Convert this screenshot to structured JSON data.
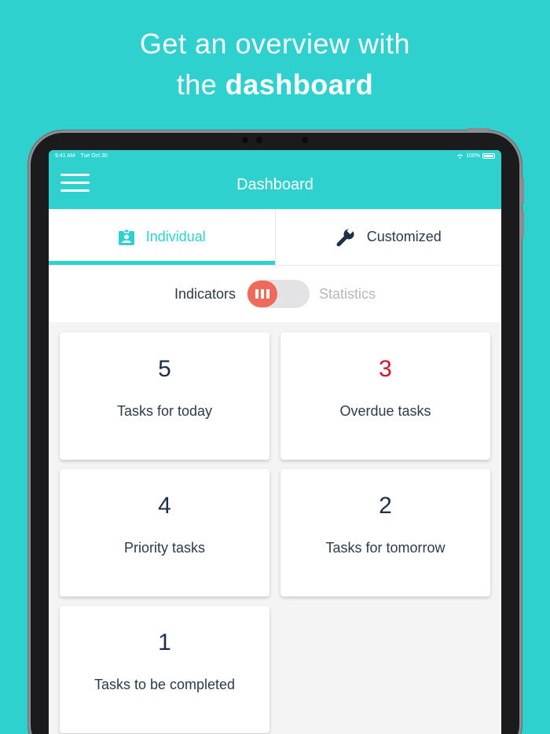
{
  "headline": {
    "line1": "Get an overview with",
    "line2_prefix": "the",
    "line2_bold": "dashboard"
  },
  "status_bar": {
    "time": "9:41 AM",
    "date": "Tue Oct 30",
    "battery": "100%"
  },
  "app_bar": {
    "title": "Dashboard",
    "menu_icon": "hamburger-menu-icon"
  },
  "tabs": [
    {
      "label": "Individual",
      "icon": "id-badge-icon",
      "active": true
    },
    {
      "label": "Customized",
      "icon": "wrench-icon",
      "active": false
    }
  ],
  "view_toggle": {
    "left_label": "Indicators",
    "right_label": "Statistics",
    "selected": "Indicators"
  },
  "cards": [
    {
      "value": "5",
      "label": "Tasks for today"
    },
    {
      "value": "3",
      "label": "Overdue tasks",
      "highlight": "#d8102a"
    },
    {
      "value": "4",
      "label": "Priority tasks"
    },
    {
      "value": "2",
      "label": "Tasks for tomorrow"
    },
    {
      "value": "1",
      "label": "Tasks to be completed"
    }
  ],
  "colors": {
    "accent": "#2fd1cf",
    "toggle": "#ef6a5b",
    "overdue": "#d8102a",
    "text": "#2d3a4a"
  }
}
